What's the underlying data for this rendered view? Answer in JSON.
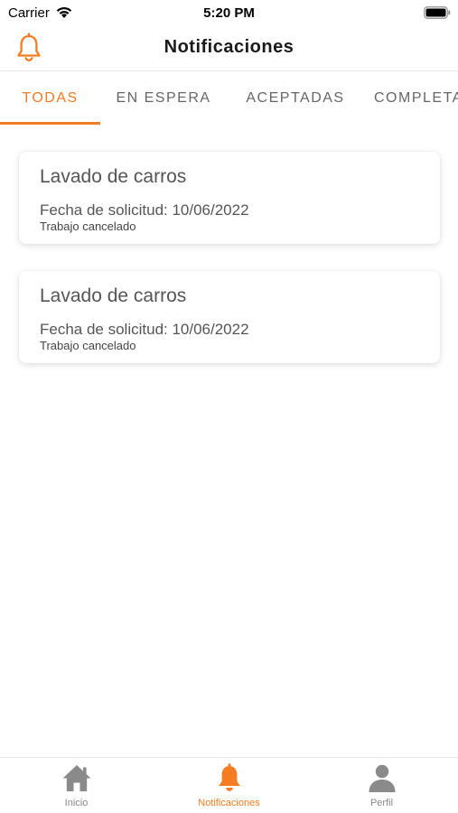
{
  "status_bar": {
    "carrier": "Carrier",
    "time": "5:20 PM"
  },
  "header": {
    "title": "Notificaciones",
    "icon": "bell-icon"
  },
  "tabs": [
    {
      "label": "TODAS",
      "active": true
    },
    {
      "label": "EN ESPERA",
      "active": false
    },
    {
      "label": "ACEPTADAS",
      "active": false
    },
    {
      "label": "COMPLETADAS",
      "active": false
    }
  ],
  "notifications": [
    {
      "title": "Lavado de carros",
      "date": "Fecha de solicitud: 10/06/2022",
      "status": "Trabajo cancelado"
    },
    {
      "title": "Lavado de carros",
      "date": "Fecha de solicitud: 10/06/2022",
      "status": "Trabajo cancelado"
    }
  ],
  "bottom_nav": [
    {
      "label": "Inicio",
      "icon": "home-icon",
      "active": false
    },
    {
      "label": "Notificaciones",
      "icon": "bell-icon",
      "active": true
    },
    {
      "label": "Perfil",
      "icon": "user-icon",
      "active": false
    }
  ],
  "colors": {
    "accent": "#f57c22",
    "inactive_icon": "#8a8a8a",
    "text": "#555555"
  }
}
